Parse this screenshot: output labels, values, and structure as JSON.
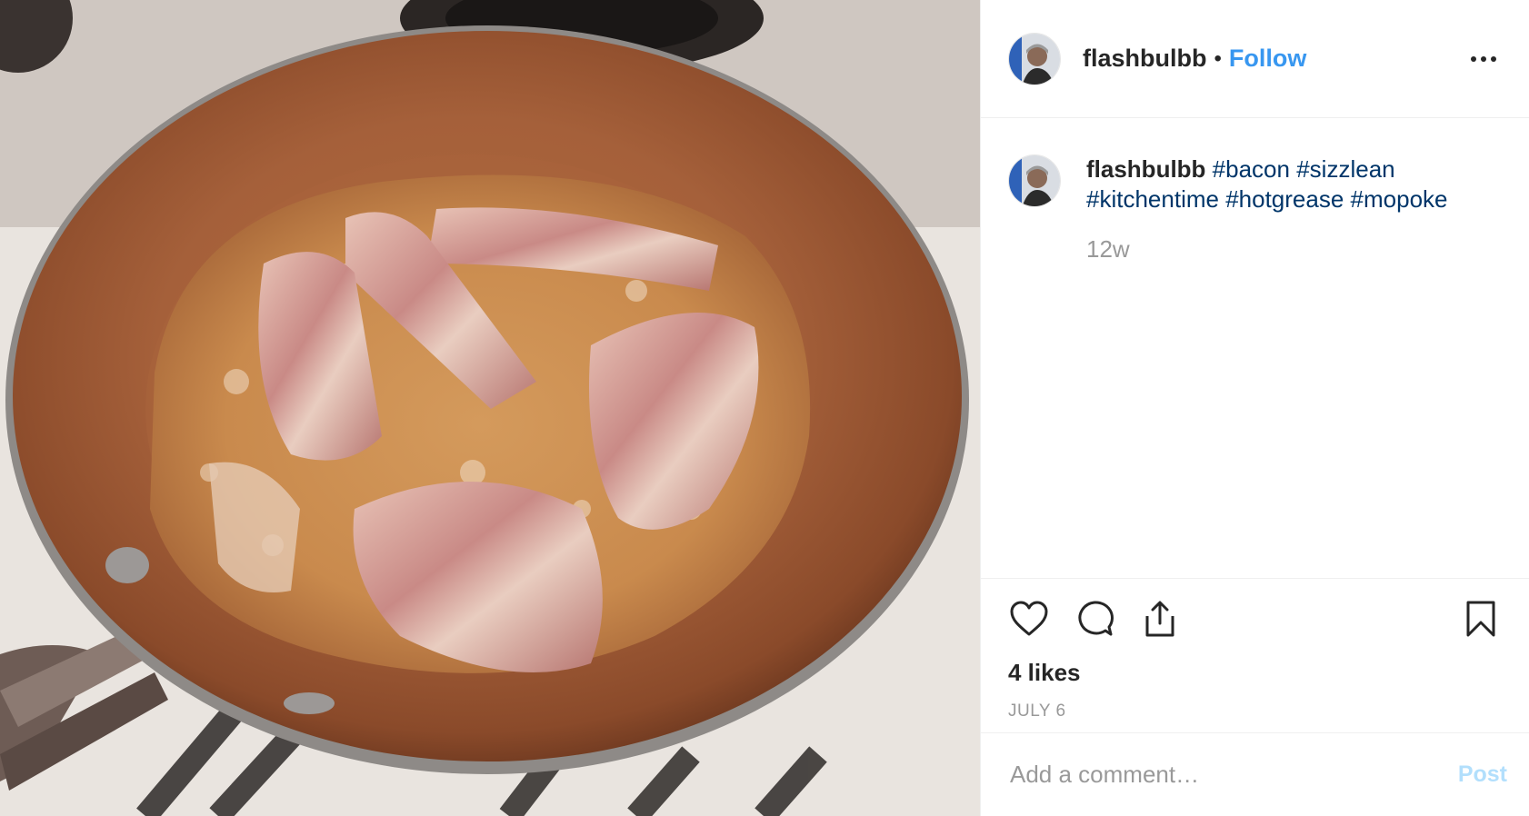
{
  "post": {
    "username": "flashbulbb",
    "follow_label": "Follow",
    "separator": "•",
    "caption": {
      "username": "flashbulbb",
      "hashtags": [
        "#bacon",
        "#sizzlean",
        "#kitchentime",
        "#hotgrease",
        "#mopoke"
      ]
    },
    "time_ago": "12w",
    "likes": "4 likes",
    "date": "JULY 6",
    "comment_placeholder": "Add a comment…",
    "post_label": "Post"
  },
  "icons": {
    "more": "more-options-icon",
    "like": "heart-icon",
    "comment": "comment-bubble-icon",
    "share": "share-icon",
    "save": "bookmark-icon"
  },
  "colors": {
    "link": "#3897f0",
    "hashtag": "#003569",
    "muted": "#999999",
    "post_disabled": "#b2dffc"
  }
}
